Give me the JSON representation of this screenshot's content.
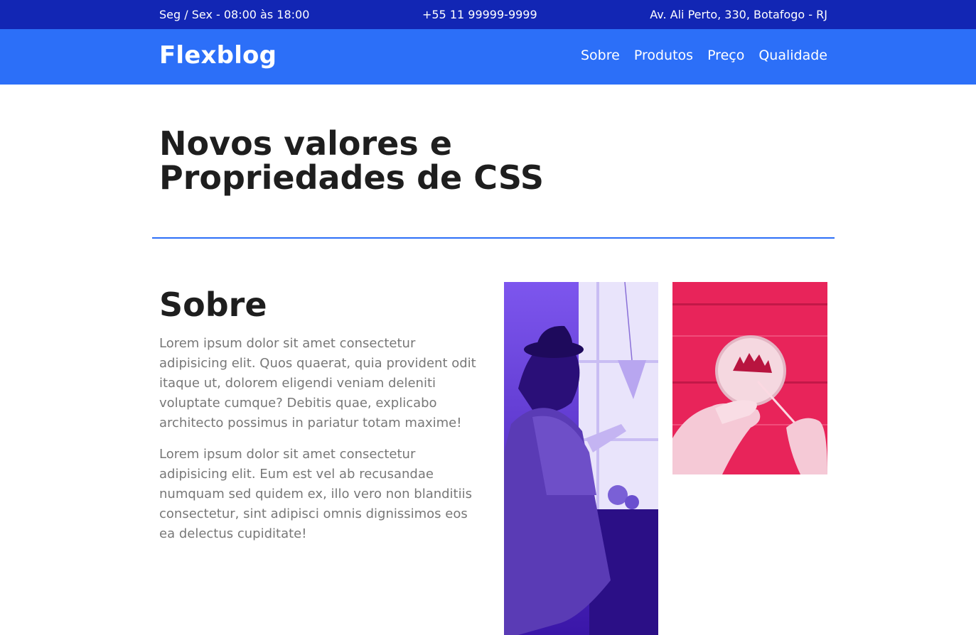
{
  "topbar": {
    "hours": "Seg / Sex - 08:00 às 18:00",
    "phone": "+55 11 99999-9999",
    "address": "Av. Ali Perto, 330, Botafogo - RJ"
  },
  "header": {
    "logo": "Flexblog",
    "nav": [
      "Sobre",
      "Produtos",
      "Preço",
      "Qualidade"
    ]
  },
  "hero": {
    "title_line1": "Novos valores e",
    "title_line2": "Propriedades de CSS"
  },
  "about": {
    "heading": "Sobre",
    "paragraph1": "Lorem ipsum dolor sit amet consectetur adipisicing elit. Quos quaerat, quia provident odit itaque ut, dolorem eligendi veniam deleniti voluptate cumque? Debitis quae, explicabo architecto possimus in pariatur totam maxime!",
    "paragraph2": "Lorem ipsum dolor sit amet consectetur adipisicing elit. Eum est vel ab recusandae numquam sed quidem ex, illo vero non blanditiis consectetur, sint adipisci omnis dignissimos eos ea delectus cupiditate!"
  },
  "colors": {
    "topbar": "#1226b4",
    "header": "#2c6ff8",
    "divider": "#2c6ff8",
    "photo1_tint": "#5b2fd8",
    "photo2_tint": "#e8245a"
  }
}
